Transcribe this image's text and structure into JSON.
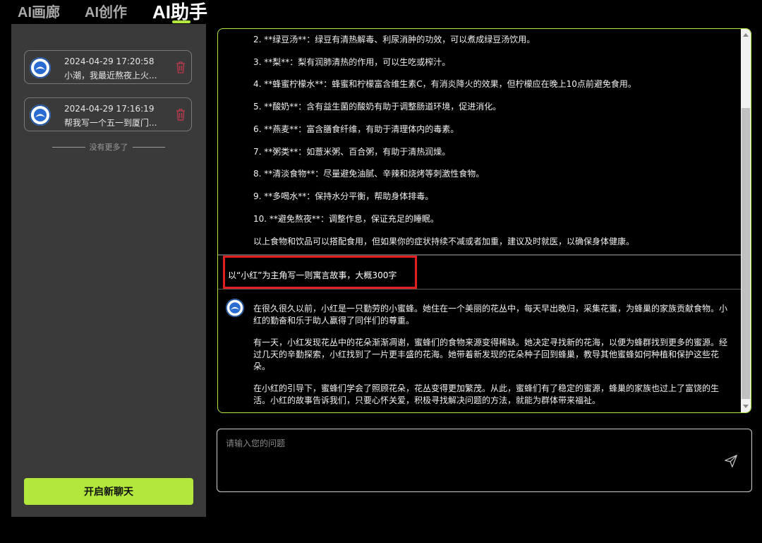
{
  "nav": {
    "tabs": [
      "AI画廊",
      "AI创作",
      "AI助手"
    ],
    "active": "AI助手"
  },
  "sidebar": {
    "history": [
      {
        "date": "2024-04-29 17:20:58",
        "title": "小潮，我最近熬夜上火..."
      },
      {
        "date": "2024-04-29 17:16:19",
        "title": "帮我写一个五一到厦门..."
      }
    ],
    "no_more": "没有更多了",
    "new_chat": "开启新聊天"
  },
  "chat": {
    "previous_ai_items": [
      "2. **绿豆汤**：绿豆有清热解毒、利尿消肿的功效，可以煮成绿豆汤饮用。",
      "3. **梨**：梨有润肺清热的作用，可以生吃或榨汁。",
      "4. **蜂蜜柠檬水**：蜂蜜和柠檬富含维生素C，有消炎降火的效果，但柠檬应在晚上10点前避免食用。",
      "5. **酸奶**：含有益生菌的酸奶有助于调整肠道环境，促进消化。",
      "6. **燕麦**：富含膳食纤维，有助于清理体内的毒素。",
      "7. **粥类**：如薏米粥、百合粥，有助于清热润燥。",
      "8. **清淡食物**：尽量避免油腻、辛辣和烧烤等刺激性食物。",
      "9. **多喝水**：保持水分平衡，帮助身体排毒。",
      "10. **避免熬夜**：调整作息，保证充足的睡眠。",
      "以上食物和饮品可以搭配食用，但如果你的症状持续不减或者加重，建议及时就医，以确保身体健康。"
    ],
    "user_message": "以“小红”为主角写一则寓言故事，大概300字",
    "ai_reply": [
      "在很久很久以前，小红是一只勤劳的小蜜蜂。她住在一个美丽的花丛中，每天早出晚归，采集花蜜，为蜂巢的家族贡献食物。小红的勤奋和乐于助人赢得了同伴们的尊重。",
      "有一天，小红发现花丛中的花朵渐渐凋谢，蜜蜂们的食物来源变得稀缺。她决定寻找新的花海，以便为蜂群找到更多的蜜源。经过几天的辛勤探索，小红找到了一片更丰盛的花海。她带着新发现的花朵种子回到蜂巢，教导其他蜜蜂如何种植和保护这些花朵。",
      "在小红的引导下，蜜蜂们学会了照顾花朵，花丛变得更加繁茂。从此，蜜蜂们有了稳定的蜜源，蜂巢的家族也过上了富饶的生活。小红的故事告诉我们，只要心怀关爱，积极寻找解决问题的方法，就能为群体带来福祉。"
    ]
  },
  "input": {
    "placeholder": "请输入您的问题"
  },
  "colors": {
    "accent": "#b2e83b",
    "highlight": "#e02020",
    "trash": "#c0394a"
  }
}
